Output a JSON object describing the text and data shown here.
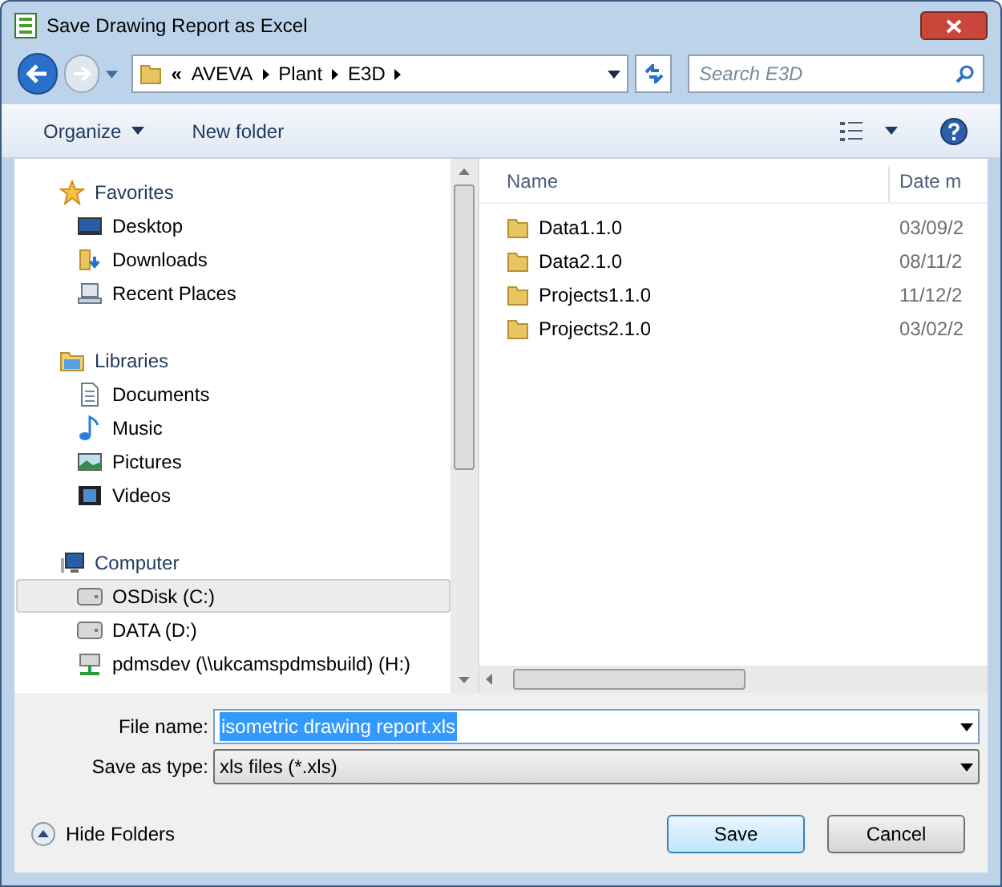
{
  "window": {
    "title": "Save Drawing Report as Excel"
  },
  "breadcrumb": {
    "overflow": "«",
    "segments": [
      "AVEVA",
      "Plant",
      "E3D"
    ]
  },
  "search": {
    "placeholder": "Search E3D"
  },
  "toolbar": {
    "organize": "Organize",
    "new_folder": "New folder"
  },
  "sidebar": {
    "groups": [
      {
        "label": "Favorites",
        "kind": "star",
        "children": [
          {
            "label": "Desktop",
            "kind": "desktop",
            "selected": false
          },
          {
            "label": "Downloads",
            "kind": "downloads",
            "selected": false
          },
          {
            "label": "Recent Places",
            "kind": "recent",
            "selected": false
          }
        ]
      },
      {
        "label": "Libraries",
        "kind": "library",
        "children": [
          {
            "label": "Documents",
            "kind": "document",
            "selected": false
          },
          {
            "label": "Music",
            "kind": "music",
            "selected": false
          },
          {
            "label": "Pictures",
            "kind": "picture",
            "selected": false
          },
          {
            "label": "Videos",
            "kind": "video",
            "selected": false
          }
        ]
      },
      {
        "label": "Computer",
        "kind": "computer",
        "children": [
          {
            "label": "OSDisk (C:)",
            "kind": "drive",
            "selected": true
          },
          {
            "label": "DATA (D:)",
            "kind": "drive",
            "selected": false
          },
          {
            "label": "pdmsdev (\\\\ukcamspdmsbuild) (H:)",
            "kind": "network",
            "selected": false
          }
        ]
      }
    ]
  },
  "file_list": {
    "columns": [
      "Name",
      "Date m"
    ],
    "rows": [
      {
        "name": "Data1.1.0",
        "date": "03/09/2"
      },
      {
        "name": "Data2.1.0",
        "date": "08/11/2"
      },
      {
        "name": "Projects1.1.0",
        "date": "11/12/2"
      },
      {
        "name": "Projects2.1.0",
        "date": "03/02/2"
      }
    ]
  },
  "form": {
    "file_name_label": "File name:",
    "file_name": "isometric drawing report.xls",
    "type_label": "Save as type:",
    "type": "xls files (*.xls)"
  },
  "hide_folders": "Hide Folders",
  "buttons": {
    "save": "Save",
    "cancel": "Cancel"
  }
}
